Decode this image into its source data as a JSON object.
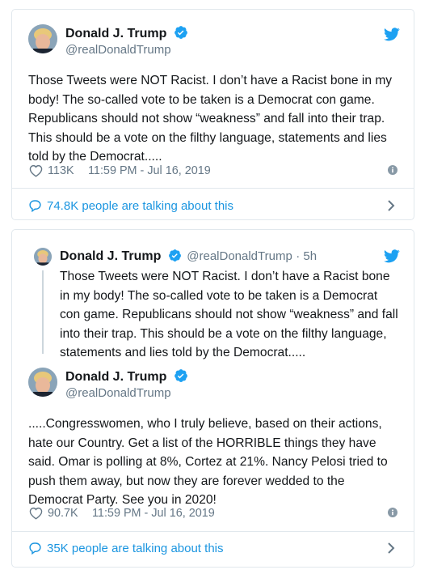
{
  "colors": {
    "link": "#1b95e0",
    "verified": "#1da1f2",
    "muted": "#657786",
    "text": "#14171a",
    "border": "#e1e8ed"
  },
  "card1": {
    "author_name": "Donald J. Trump",
    "author_handle": "@realDonaldTrump",
    "text": "Those Tweets were NOT Racist. I don’t have a Racist bone in my body! The so-called vote to be taken is a Democrat con game. Republicans should not show “weakness” and fall into their trap. This should be a vote on the filthy language, statements and lies told by the Democrat.....",
    "likes": "113K",
    "timestamp": "11:59 PM - Jul 16, 2019",
    "talking": "74.8K people are talking about this",
    "icons": [
      "twitter-bird-icon",
      "verified-badge-icon",
      "heart-icon",
      "info-icon",
      "chat-bubble-icon",
      "chevron-right-icon"
    ]
  },
  "card2": {
    "quoted": {
      "author_name": "Donald J. Trump",
      "author_handle": "@realDonaldTrump",
      "time_ago": "· 5h",
      "text": "Those Tweets were NOT Racist. I don’t have a Racist bone in my body! The so-called vote to be taken is a Democrat con game. Republicans should not show “weakness” and fall into their trap. This should be a vote on the filthy language, statements and lies told by the Democrat....."
    },
    "author_name": "Donald J. Trump",
    "author_handle": "@realDonaldTrump",
    "text": ".....Congresswomen, who I truly believe, based on their actions, hate our Country. Get a list of the HORRIBLE things they have said. Omar is polling at 8%, Cortez at 21%. Nancy Pelosi tried to push them away, but now they are forever wedded to the Democrat Party. See you in 2020!",
    "likes": "90.7K",
    "timestamp": "11:59 PM - Jul 16, 2019",
    "talking": "35K people are talking about this"
  }
}
